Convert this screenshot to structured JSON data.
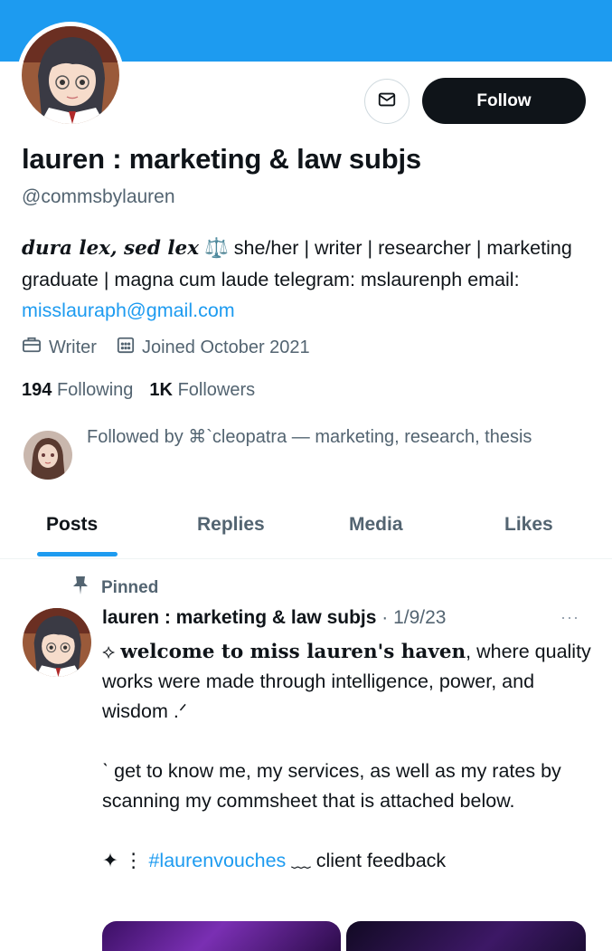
{
  "profile": {
    "display_name": "lauren : marketing & law subjs",
    "handle": "@commsbylauren",
    "follow_label": "Follow",
    "message_icon": "envelope-icon",
    "bio_fancy": "dura lex, sed lex",
    "bio_emoji": "⚖️",
    "bio_rest": " she/her | writer | researcher | marketing graduate | magna cum laude telegram: mslaurenph email: ",
    "bio_link": "misslauraph@gmail.com",
    "occupation": "Writer",
    "joined": "Joined October 2021",
    "following_count": "194",
    "following_label": "Following",
    "followers_count": "1K",
    "followers_label": "Followers",
    "followed_by": "Followed by ⌘`cleopatra — marketing, research, thesis"
  },
  "tabs": [
    {
      "label": "Posts",
      "active": true
    },
    {
      "label": "Replies",
      "active": false
    },
    {
      "label": "Media",
      "active": false
    },
    {
      "label": "Likes",
      "active": false
    }
  ],
  "pinned_post": {
    "pinned_label": "Pinned",
    "author": "lauren : marketing & law subjs",
    "date": "· 1/9/23",
    "more": "···",
    "line1_prefix": "⟡ ",
    "line1_bold": "welcome to miss lauren's haven",
    "line1_rest": ", where quality works were made through intelligence, power, and wisdom .ᐟ",
    "line2": "ˋ get to know me, my services, as well as my rates by scanning my commsheet that is attached below.",
    "line3_prefix": "✦ ⋮ ",
    "line3_hashtag": "#laurenvouches",
    "line3_rest": " ﹏ client feedback"
  },
  "colors": {
    "banner": "#1d9bf0",
    "accent": "#1d9bf0",
    "text": "#0f1419",
    "muted": "#536471"
  }
}
